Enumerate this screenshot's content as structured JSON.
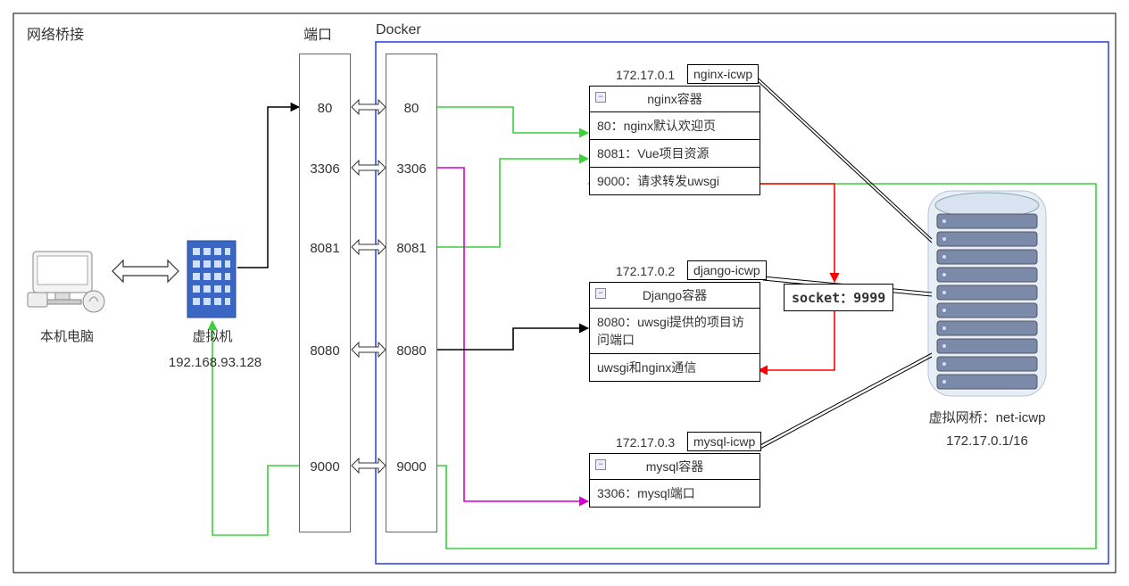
{
  "labels": {
    "network_bridge": "网络桥接",
    "ports": "端口",
    "docker": "Docker",
    "local_pc": "本机电脑",
    "vm": "虚拟机",
    "vm_ip": "192.168.93.128",
    "virtual_bridge": "虚拟网桥：net-icwp",
    "virtual_bridge_ip": "172.17.0.1/16"
  },
  "ports_left": {
    "p80": "80",
    "p3306": "3306",
    "p8081": "8081",
    "p8080": "8080",
    "p9000": "9000"
  },
  "ports_right": {
    "p80": "80",
    "p3306": "3306",
    "p8081": "8081",
    "p8080": "8080",
    "p9000": "9000"
  },
  "nginx": {
    "ip": "172.17.0.1",
    "name": "nginx-icwp",
    "title": "nginx容器",
    "row1": "80：nginx默认欢迎页",
    "row2": "8081：Vue项目资源",
    "row3": "9000：请求转发uwsgi"
  },
  "django": {
    "ip": "172.17.0.2",
    "name": "django-icwp",
    "title": "Django容器",
    "row1": "8080：uwsgi提供的项目访问端口",
    "row2": "uwsgi和nginx通信"
  },
  "mysql": {
    "ip": "172.17.0.3",
    "name": "mysql-icwp",
    "title": "mysql容器",
    "row1": "3306：mysql端口"
  },
  "socket": "socket：9999"
}
